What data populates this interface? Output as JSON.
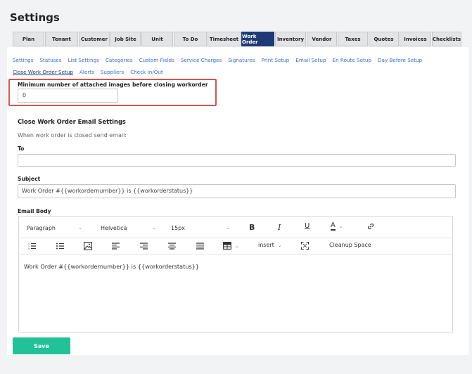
{
  "page_title": "Settings",
  "tabs": [
    {
      "label": "Plan"
    },
    {
      "label": "Tenant"
    },
    {
      "label": "Customer"
    },
    {
      "label": "Job Site"
    },
    {
      "label": "Unit"
    },
    {
      "label": "To Do"
    },
    {
      "label": "Timesheet"
    },
    {
      "label": "Work Order"
    },
    {
      "label": "Inventory"
    },
    {
      "label": "Vendor"
    },
    {
      "label": "Taxes"
    },
    {
      "label": "Quotes"
    },
    {
      "label": "Invoices"
    },
    {
      "label": "Checklists"
    }
  ],
  "subnav_row1": [
    "Settings",
    "Statuses",
    "List Settings",
    "Categories",
    "Custom Fields",
    "Service Charges",
    "Signatures",
    "Print Setup",
    "Email Setup",
    "En Route Setup",
    "Day Before Setup"
  ],
  "subnav_row2": [
    "Close Work Order Setup",
    "Alerts",
    "Suppliers",
    "Check In/Out"
  ],
  "min_images": {
    "label": "Minimum number of attached images before closing workorder",
    "value": "0"
  },
  "email_settings": {
    "title": "Close Work Order Email Settings",
    "subtitle": "When work order is closed send email:",
    "to_label": "To",
    "to_value": "",
    "subject_label": "Subject",
    "subject_value": "Work Order #{{workordernumber}} is {{workorderstatus}}",
    "body_label": "Email Body"
  },
  "editor": {
    "paragraph": "Paragraph",
    "font": "Helvetica",
    "size": "15px",
    "insert": "insert",
    "cleanup": "Cleanup Space",
    "body_text": "Work Order #{{workordernumber}} is {{workorderstatus}}"
  },
  "save_label": "Save",
  "colors": {
    "active_tab": "#1e3a76",
    "link": "#3a6fc4",
    "save": "#22c198",
    "highlight": "#d9534f"
  }
}
